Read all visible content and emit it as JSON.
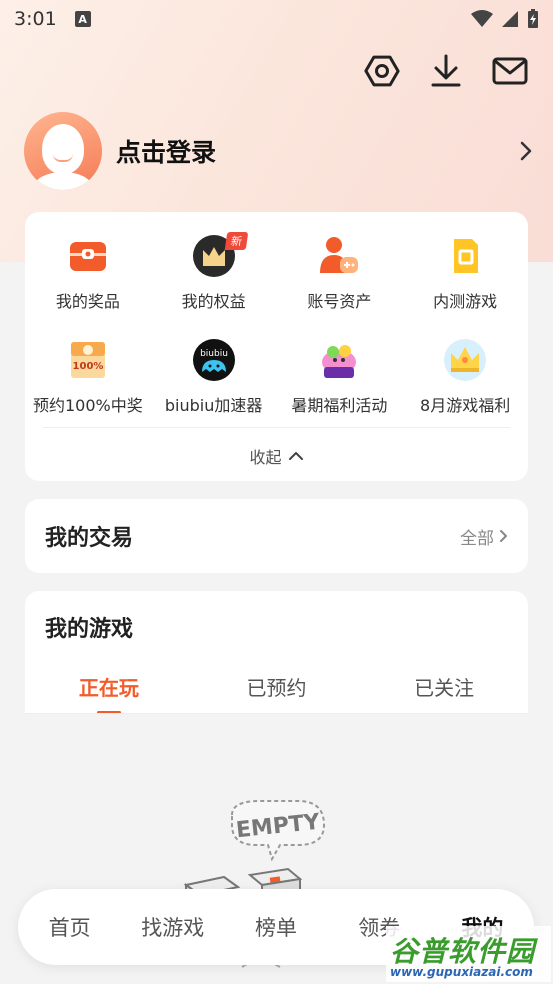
{
  "status": {
    "time": "3:01",
    "a_badge": "A"
  },
  "header": {
    "icons": [
      "settings-icon",
      "download-icon",
      "mail-icon"
    ]
  },
  "login": {
    "label": "点击登录"
  },
  "grid": {
    "items": [
      {
        "label": "我的奖品",
        "icon": "prize-icon"
      },
      {
        "label": "我的权益",
        "icon": "crown-icon",
        "badge": "新"
      },
      {
        "label": "账号资产",
        "icon": "account-assets-icon"
      },
      {
        "label": "内测游戏",
        "icon": "beta-game-icon"
      },
      {
        "label": "预约100%中奖",
        "icon": "reserve-prize-icon",
        "icon_text": "100%"
      },
      {
        "label": "biubiu加速器",
        "icon": "biubiu-icon",
        "icon_text": "biubiu"
      },
      {
        "label": "暑期福利活动",
        "icon": "summer-icon"
      },
      {
        "label": "8月游戏福利",
        "icon": "august-crown-icon"
      }
    ],
    "collapse_label": "收起"
  },
  "trade": {
    "title": "我的交易",
    "all_label": "全部"
  },
  "games": {
    "title": "我的游戏",
    "tabs": [
      "正在玩",
      "已预约",
      "已关注"
    ],
    "active_tab": 0,
    "empty_text": "EMPTY"
  },
  "bottom_nav": {
    "items": [
      "首页",
      "找游戏",
      "榜单",
      "领券",
      "我的"
    ],
    "active": 4
  },
  "watermark": {
    "big": "谷普软件园",
    "small": "www.gupuxiazai.com"
  },
  "colors": {
    "accent": "#f25b2a",
    "badge": "#f04a3a"
  }
}
